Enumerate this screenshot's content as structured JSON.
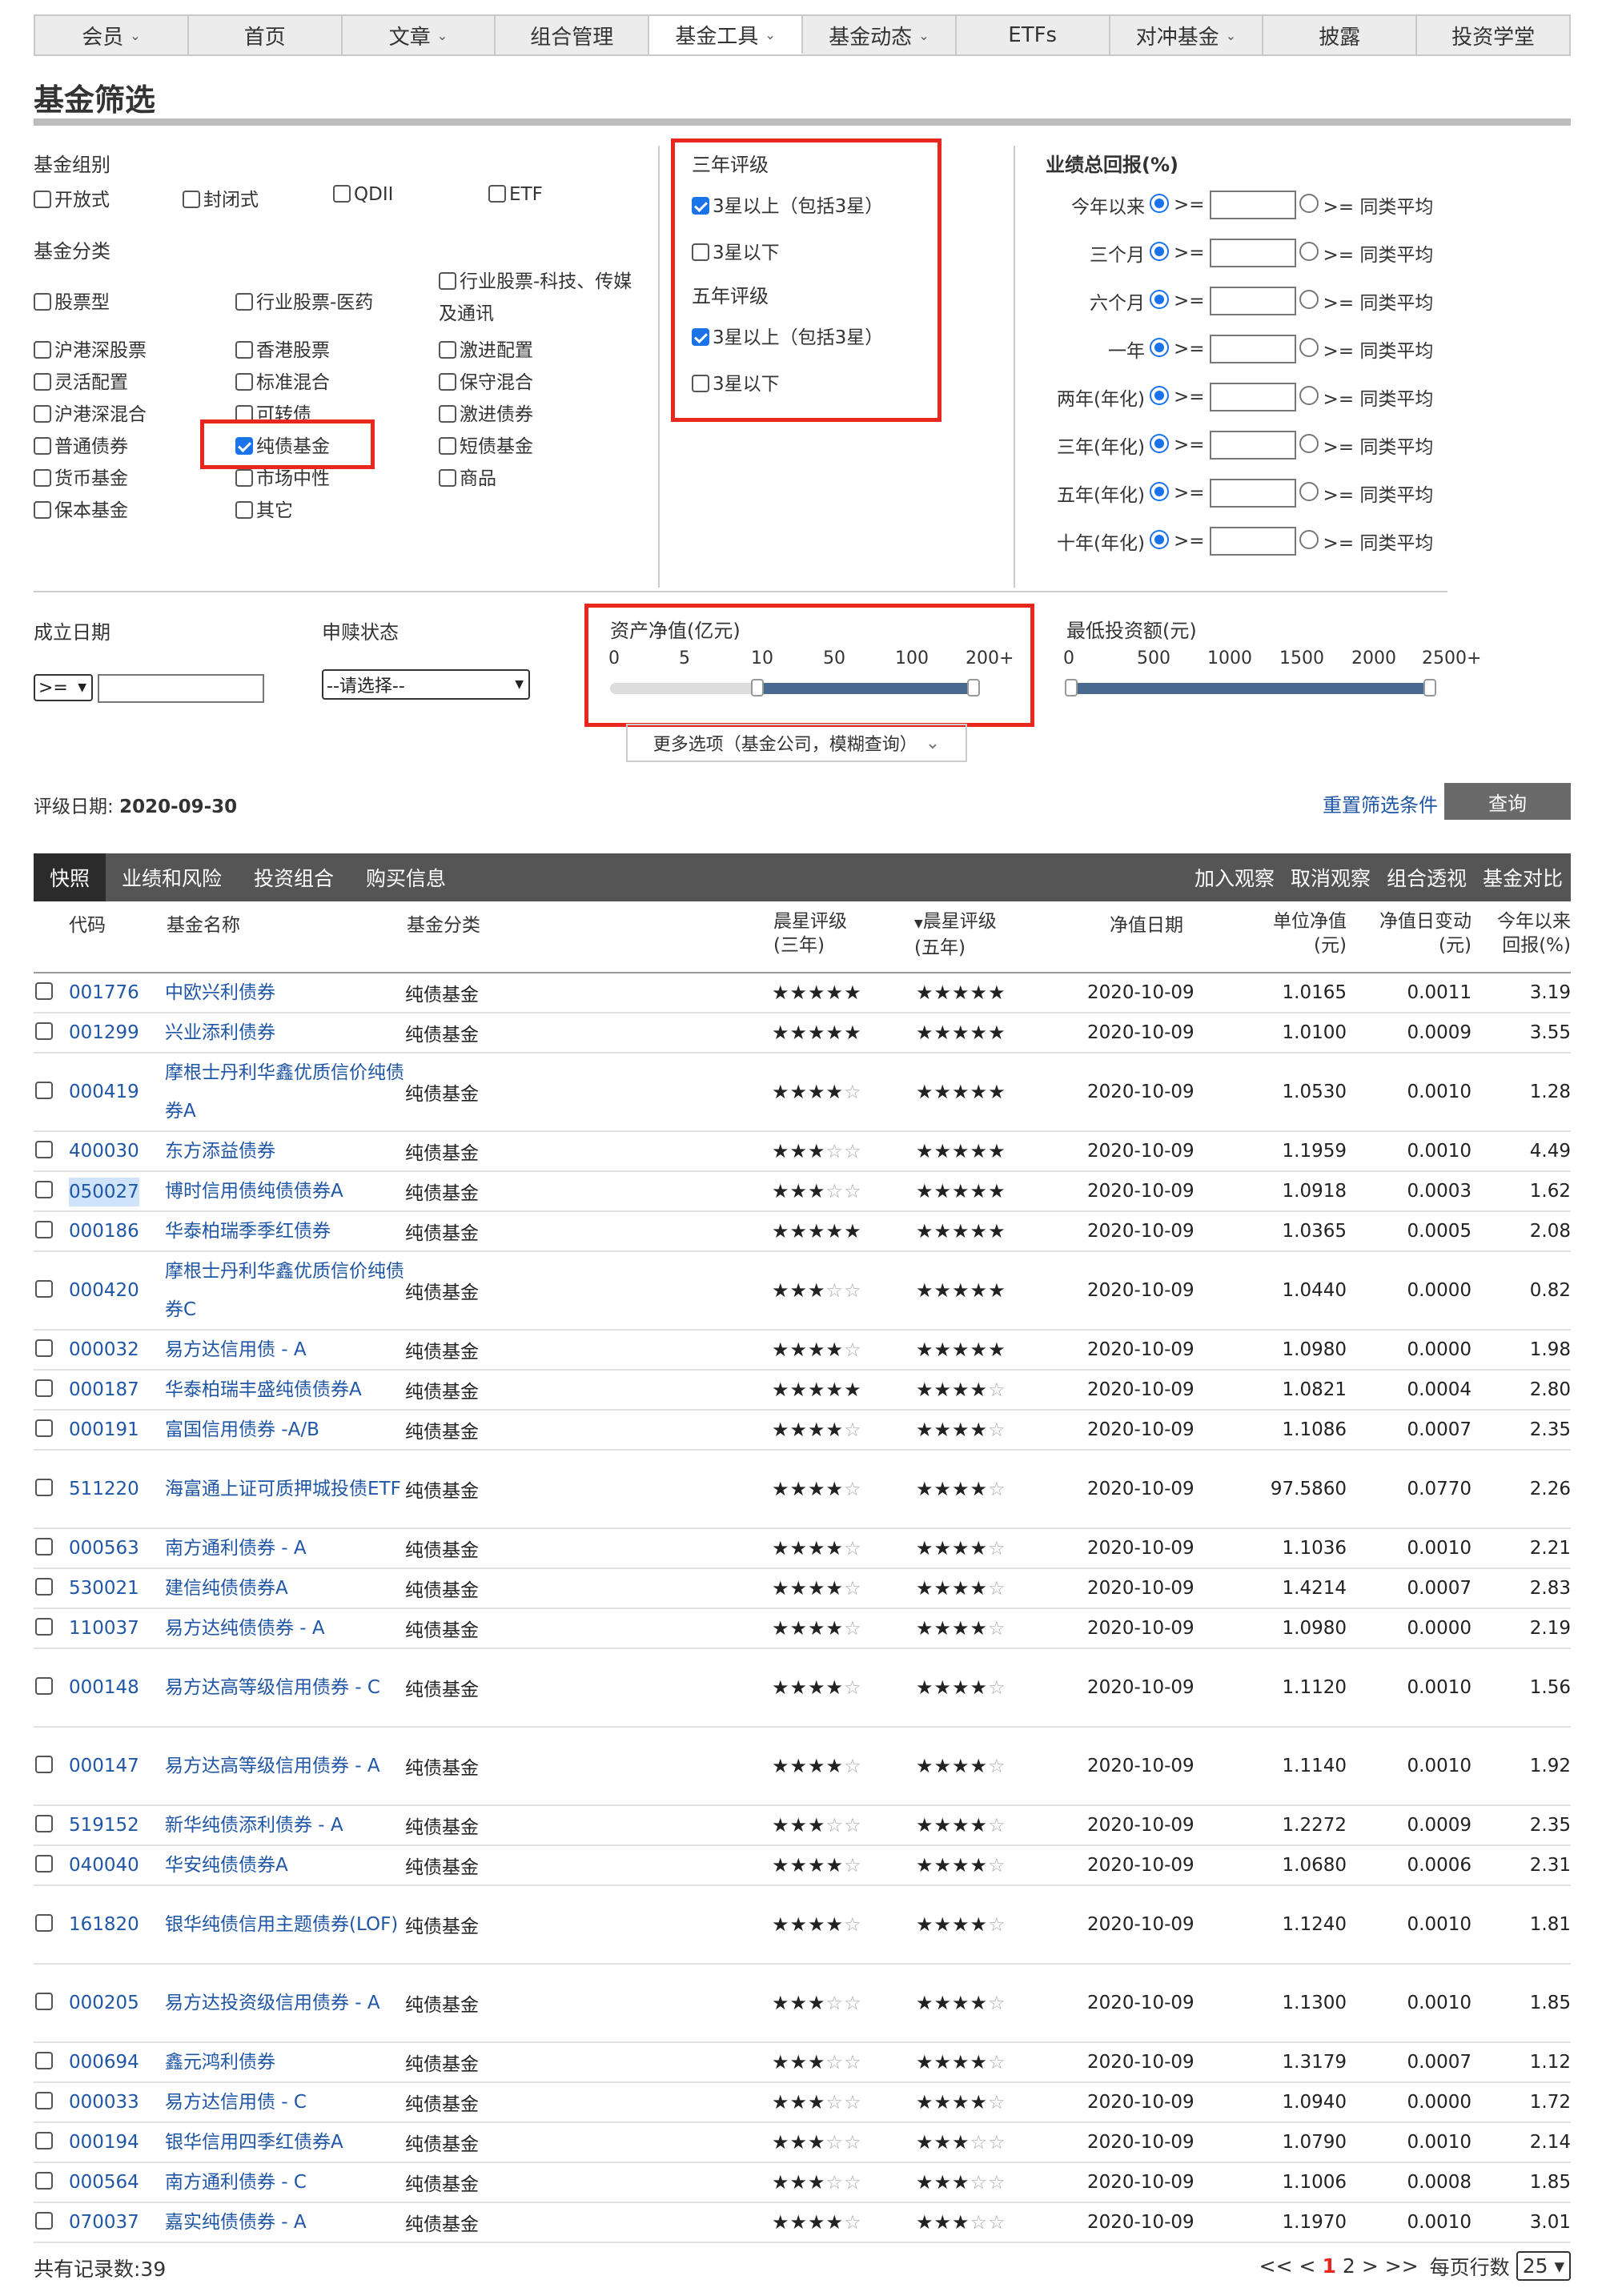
{
  "nav": {
    "tabs": [
      {
        "label": "会员",
        "caret": true
      },
      {
        "label": "首页",
        "caret": false
      },
      {
        "label": "文章",
        "caret": true
      },
      {
        "label": "组合管理",
        "caret": false
      },
      {
        "label": "基金工具",
        "caret": true,
        "active": true
      },
      {
        "label": "基金动态",
        "caret": true
      },
      {
        "label": "ETFs",
        "caret": false
      },
      {
        "label": "对冲基金",
        "caret": true
      },
      {
        "label": "披露",
        "caret": false
      },
      {
        "label": "投资学堂",
        "caret": false
      }
    ]
  },
  "page_title": "基金筛选",
  "filters": {
    "group_label": "基金组别",
    "groups": [
      "开放式",
      "封闭式",
      "QDII",
      "ETF"
    ],
    "category_label": "基金分类",
    "categories": [
      {
        "label": "股票型",
        "checked": false
      },
      {
        "label": "行业股票-医药",
        "checked": false
      },
      {
        "label": "行业股票-科技、传媒及通讯",
        "checked": false
      },
      {
        "label": "沪港深股票",
        "checked": false
      },
      {
        "label": "香港股票",
        "checked": false
      },
      {
        "label": "激进配置",
        "checked": false
      },
      {
        "label": "灵活配置",
        "checked": false
      },
      {
        "label": "标准混合",
        "checked": false
      },
      {
        "label": "保守混合",
        "checked": false
      },
      {
        "label": "沪港深混合",
        "checked": false
      },
      {
        "label": "可转债",
        "checked": false
      },
      {
        "label": "激进债券",
        "checked": false
      },
      {
        "label": "普通债券",
        "checked": false
      },
      {
        "label": "纯债基金",
        "checked": true
      },
      {
        "label": "短债基金",
        "checked": false
      },
      {
        "label": "货币基金",
        "checked": false
      },
      {
        "label": "市场中性",
        "checked": false
      },
      {
        "label": "商品",
        "checked": false
      },
      {
        "label": "保本基金",
        "checked": false
      },
      {
        "label": "其它",
        "checked": false
      }
    ],
    "rating3_label": "三年评级",
    "rating3": [
      {
        "label": "3星以上（包括3星）",
        "checked": true
      },
      {
        "label": "3星以下",
        "checked": false
      }
    ],
    "rating5_label": "五年评级",
    "rating5": [
      {
        "label": "3星以上（包括3星）",
        "checked": true
      },
      {
        "label": "3星以下",
        "checked": false
      }
    ],
    "perf_label": "业绩总回报(%)",
    "perf_rows": [
      "今年以来",
      "三个月",
      "六个月",
      "一年",
      "两年(年化)",
      "三年(年化)",
      "五年(年化)",
      "十年(年化)"
    ],
    "perf_ge": ">=",
    "perf_avg": ">= 同类平均",
    "inception_label": "成立日期",
    "inception_op": ">=",
    "purchase_label": "申赎状态",
    "purchase_select": "--请选择--",
    "aum_label": "资产净值(亿元)",
    "aum_ticks": [
      "0",
      "5",
      "10",
      "50",
      "100",
      "200+"
    ],
    "aum_range": [
      "10",
      "200+"
    ],
    "min_invest_label": "最低投资额(元)",
    "min_invest_ticks": [
      "0",
      "500",
      "1000",
      "1500",
      "2000",
      "2500+"
    ],
    "min_invest_range": [
      "0",
      "2500+"
    ],
    "more_options": "更多选项（基金公司，模糊查询）",
    "rating_date_label": "评级日期:",
    "rating_date": "2020-09-30",
    "reset": "重置筛选条件",
    "query": "查询"
  },
  "result_tabs": [
    "快照",
    "业绩和风险",
    "投资组合",
    "购买信息"
  ],
  "result_actions": [
    "加入观察",
    "取消观察",
    "组合透视",
    "基金对比"
  ],
  "columns": {
    "code": "代码",
    "name": "基金名称",
    "cat": "基金分类",
    "s3": "晨星评级",
    "s3b": "(三年)",
    "s5": "晨星评级",
    "s5b": "(五年)",
    "date": "净值日期",
    "nav": "单位净值",
    "navb": "(元)",
    "chg": "净值日变动",
    "chgb": "(元)",
    "ret": "今年以来",
    "retb": "回报(%)"
  },
  "rows": [
    {
      "code": "001776",
      "name": "中欧兴利债券",
      "cat": "纯债基金",
      "s3": 5,
      "s5": 5,
      "date": "2020-10-09",
      "nav": "1.0165",
      "chg": "0.0011",
      "ret": "3.19"
    },
    {
      "code": "001299",
      "name": "兴业添利债券",
      "cat": "纯债基金",
      "s3": 5,
      "s5": 5,
      "date": "2020-10-09",
      "nav": "1.0100",
      "chg": "0.0009",
      "ret": "3.55"
    },
    {
      "code": "000419",
      "name": "摩根士丹利华鑫优质信价纯债券A",
      "cat": "纯债基金",
      "s3": 4,
      "s5": 5,
      "date": "2020-10-09",
      "nav": "1.0530",
      "chg": "0.0010",
      "ret": "1.28"
    },
    {
      "code": "400030",
      "name": "东方添益债券",
      "cat": "纯债基金",
      "s3": 3,
      "s5": 5,
      "date": "2020-10-09",
      "nav": "1.1959",
      "chg": "0.0010",
      "ret": "4.49"
    },
    {
      "code": "050027",
      "name": "博时信用债纯债债券A",
      "cat": "纯债基金",
      "s3": 3,
      "s5": 5,
      "date": "2020-10-09",
      "nav": "1.0918",
      "chg": "0.0003",
      "ret": "1.62"
    },
    {
      "code": "000186",
      "name": "华泰柏瑞季季红债券",
      "cat": "纯债基金",
      "s3": 5,
      "s5": 5,
      "date": "2020-10-09",
      "nav": "1.0365",
      "chg": "0.0005",
      "ret": "2.08"
    },
    {
      "code": "000420",
      "name": "摩根士丹利华鑫优质信价纯债券C",
      "cat": "纯债基金",
      "s3": 3,
      "s5": 5,
      "date": "2020-10-09",
      "nav": "1.0440",
      "chg": "0.0000",
      "ret": "0.82"
    },
    {
      "code": "000032",
      "name": "易方达信用债 - A",
      "cat": "纯债基金",
      "s3": 4,
      "s5": 5,
      "date": "2020-10-09",
      "nav": "1.0980",
      "chg": "0.0000",
      "ret": "1.98"
    },
    {
      "code": "000187",
      "name": "华泰柏瑞丰盛纯债债券A",
      "cat": "纯债基金",
      "s3": 5,
      "s5": 4,
      "date": "2020-10-09",
      "nav": "1.0821",
      "chg": "0.0004",
      "ret": "2.80"
    },
    {
      "code": "000191",
      "name": "富国信用债券 -A/B",
      "cat": "纯债基金",
      "s3": 4,
      "s5": 4,
      "date": "2020-10-09",
      "nav": "1.1086",
      "chg": "0.0007",
      "ret": "2.35"
    },
    {
      "code": "511220",
      "name": "海富通上证可质押城投债ETF",
      "cat": "纯债基金",
      "s3": 4,
      "s5": 4,
      "date": "2020-10-09",
      "nav": "97.5860",
      "chg": "0.0770",
      "ret": "2.26"
    },
    {
      "code": "000563",
      "name": "南方通利债券 - A",
      "cat": "纯债基金",
      "s3": 4,
      "s5": 4,
      "date": "2020-10-09",
      "nav": "1.1036",
      "chg": "0.0010",
      "ret": "2.21"
    },
    {
      "code": "530021",
      "name": "建信纯债债券A",
      "cat": "纯债基金",
      "s3": 4,
      "s5": 4,
      "date": "2020-10-09",
      "nav": "1.4214",
      "chg": "0.0007",
      "ret": "2.83"
    },
    {
      "code": "110037",
      "name": "易方达纯债债券 - A",
      "cat": "纯债基金",
      "s3": 4,
      "s5": 4,
      "date": "2020-10-09",
      "nav": "1.0980",
      "chg": "0.0000",
      "ret": "2.19"
    },
    {
      "code": "000148",
      "name": "易方达高等级信用债券 - C",
      "cat": "纯债基金",
      "s3": 4,
      "s5": 4,
      "date": "2020-10-09",
      "nav": "1.1120",
      "chg": "0.0010",
      "ret": "1.56"
    },
    {
      "code": "000147",
      "name": "易方达高等级信用债券 - A",
      "cat": "纯债基金",
      "s3": 4,
      "s5": 4,
      "date": "2020-10-09",
      "nav": "1.1140",
      "chg": "0.0010",
      "ret": "1.92"
    },
    {
      "code": "519152",
      "name": "新华纯债添利债券 - A",
      "cat": "纯债基金",
      "s3": 3,
      "s5": 4,
      "date": "2020-10-09",
      "nav": "1.2272",
      "chg": "0.0009",
      "ret": "2.35"
    },
    {
      "code": "040040",
      "name": "华安纯债债券A",
      "cat": "纯债基金",
      "s3": 4,
      "s5": 4,
      "date": "2020-10-09",
      "nav": "1.0680",
      "chg": "0.0006",
      "ret": "2.31"
    },
    {
      "code": "161820",
      "name": "银华纯债信用主题债券(LOF)",
      "cat": "纯债基金",
      "s3": 4,
      "s5": 4,
      "date": "2020-10-09",
      "nav": "1.1240",
      "chg": "0.0010",
      "ret": "1.81"
    },
    {
      "code": "000205",
      "name": "易方达投资级信用债券 - A",
      "cat": "纯债基金",
      "s3": 3,
      "s5": 4,
      "date": "2020-10-09",
      "nav": "1.1300",
      "chg": "0.0010",
      "ret": "1.85"
    },
    {
      "code": "000694",
      "name": "鑫元鸿利债券",
      "cat": "纯债基金",
      "s3": 3,
      "s5": 4,
      "date": "2020-10-09",
      "nav": "1.3179",
      "chg": "0.0007",
      "ret": "1.12"
    },
    {
      "code": "000033",
      "name": "易方达信用债 - C",
      "cat": "纯债基金",
      "s3": 3,
      "s5": 4,
      "date": "2020-10-09",
      "nav": "1.0940",
      "chg": "0.0000",
      "ret": "1.72"
    },
    {
      "code": "000194",
      "name": "银华信用四季红债券A",
      "cat": "纯债基金",
      "s3": 3,
      "s5": 3,
      "date": "2020-10-09",
      "nav": "1.0790",
      "chg": "0.0010",
      "ret": "2.14"
    },
    {
      "code": "000564",
      "name": "南方通利债券 - C",
      "cat": "纯债基金",
      "s3": 3,
      "s5": 3,
      "date": "2020-10-09",
      "nav": "1.1006",
      "chg": "0.0008",
      "ret": "1.85"
    },
    {
      "code": "070037",
      "name": "嘉实纯债债券 - A",
      "cat": "纯债基金",
      "s3": 4,
      "s5": 3,
      "date": "2020-10-09",
      "nav": "1.1970",
      "chg": "0.0010",
      "ret": "3.01"
    }
  ],
  "footer": {
    "count_label": "共有记录数:39",
    "pager": [
      "<<",
      "<",
      "1",
      "2",
      ">",
      ">>"
    ],
    "per_page_label": "每页行数",
    "per_page": "25"
  },
  "colors": {
    "accent_red": "#e8281e",
    "link_blue": "#1f56a6",
    "tab_bar": "#555555",
    "check_blue": "#1a73e8"
  }
}
